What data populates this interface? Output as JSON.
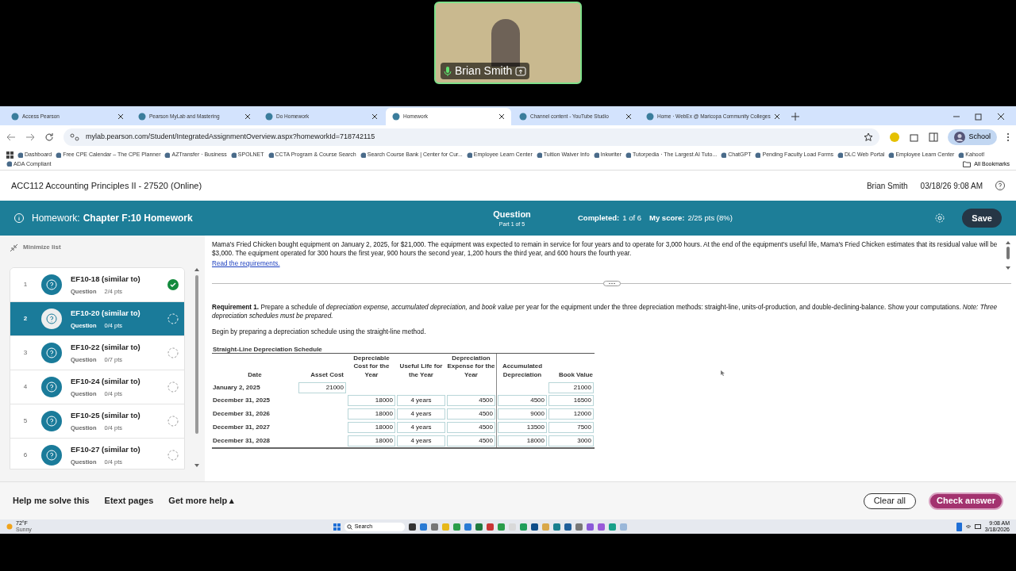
{
  "video_call": {
    "participant": "Brian Smith"
  },
  "browser": {
    "tabs": [
      {
        "title": "Access Pearson",
        "selected": false
      },
      {
        "title": "Pearson MyLab and Mastering",
        "selected": false
      },
      {
        "title": "Do Homework",
        "selected": false
      },
      {
        "title": "Homework",
        "selected": true
      },
      {
        "title": "Channel content - YouTube Studio",
        "selected": false
      },
      {
        "title": "Home · WebEx @ Maricopa Community Colleges",
        "selected": false
      }
    ],
    "url": "mylab.pearson.com/Student/IntegratedAssignmentOverview.aspx?homeworkId=718742115",
    "profile": "School",
    "bookmarks": [
      "Dashboard",
      "Free CPE Calendar – The CPE Planner",
      "AZTransfer · Business",
      "SPOLNET",
      "CCTA Program & Course Search",
      "Search Course Bank | Center for Cur...",
      "Employee Learn Center",
      "Tuition Waiver Info",
      "Inkwriter",
      "Tutorpedia · The Largest AI Tuto...",
      "ChatGPT",
      "Pending Faculty Load Forms",
      "DLC Web Portal",
      "Employee Learn Center",
      "Kahoot!",
      "ADA Compliant"
    ],
    "all_bookmarks": "All Bookmarks"
  },
  "course": {
    "title": "ACC112 Accounting Principles II - 27520 (Online)",
    "user": "Brian Smith",
    "datetime": "03/18/26 9:08 AM"
  },
  "homework_bar": {
    "label": "Homework:",
    "title": "Chapter F:10 Homework",
    "center_title": "Question",
    "part": "Part 1 of 5",
    "completed_label": "Completed:",
    "completed": "1 of 6",
    "score_label": "My score:",
    "score": "2/25 pts (8%)",
    "save": "Save"
  },
  "sidebar": {
    "minimize": "Minimize list",
    "items": [
      {
        "number": "1",
        "title": "EF10-18 (similar to)",
        "type": "Question",
        "points": "2/4 pts",
        "completed": true,
        "selected": false
      },
      {
        "number": "2",
        "title": "EF10-20 (similar to)",
        "type": "Question",
        "points": "0/4 pts",
        "completed": false,
        "selected": true
      },
      {
        "number": "3",
        "title": "EF10-22 (similar to)",
        "type": "Question",
        "points": "0/7 pts",
        "completed": false,
        "selected": false
      },
      {
        "number": "4",
        "title": "EF10-24 (similar to)",
        "type": "Question",
        "points": "0/4 pts",
        "completed": false,
        "selected": false
      },
      {
        "number": "5",
        "title": "EF10-25 (similar to)",
        "type": "Question",
        "points": "0/4 pts",
        "completed": false,
        "selected": false
      },
      {
        "number": "6",
        "title": "EF10-27 (similar to)",
        "type": "Question",
        "points": "0/4 pts",
        "completed": false,
        "selected": false
      }
    ]
  },
  "question": {
    "problem": "Mama's Fried Chicken bought equipment on January 2, 2025, for $21,000. The equipment was expected to remain in service for four years and to operate for 3,000 hours. At the end of the equipment's useful life, Mama's Fried Chicken estimates that its residual value will be $3,000. The equipment operated for 300 hours the first year, 900 hours the second year, 1,200 hours the third year, and 600 hours the fourth year.",
    "link": "Read the requirements.",
    "requirement": "**Requirement 1.** Prepare a schedule of *depreciation expense, accumulated depreciation,* and *book value* per year for the equipment under the three depreciation methods: straight-line, units-of-production, and double-declining-balance. Show your computations. *Note: Three depreciation schedules must be prepared.*",
    "instruction": "Begin by preparing a depreciation schedule using the straight-line method.",
    "table": {
      "title": "Straight-Line Depreciation Schedule",
      "columns": [
        "Date",
        "Asset Cost",
        "Depreciable Cost for the Year",
        "Useful Life for the Year",
        "Depreciation Expense for the Year",
        "Accumulated Depreciation",
        "Book Value"
      ],
      "rows": [
        {
          "cells": [
            "January 2, 2025",
            "21000",
            "",
            "",
            "",
            "",
            "21000"
          ]
        },
        {
          "cells": [
            "December 31, 2025",
            "",
            "18000",
            "4 years",
            "4500",
            "4500",
            "16500"
          ]
        },
        {
          "cells": [
            "December 31, 2026",
            "",
            "18000",
            "4 years",
            "4500",
            "9000",
            "12000"
          ]
        },
        {
          "cells": [
            "December 31, 2027",
            "",
            "18000",
            "4 years",
            "4500",
            "13500",
            "7500"
          ]
        },
        {
          "cells": [
            "December 31, 2028",
            "",
            "18000",
            "4 years",
            "4500",
            "18000",
            "3000"
          ]
        }
      ]
    }
  },
  "footer": {
    "help": [
      "Help me solve this",
      "Etext pages",
      "Get more help ▴"
    ],
    "clear": "Clear all",
    "check": "Check answer"
  },
  "taskbar": {
    "weather": "72°F",
    "weather_note": "Sunny",
    "search": "Search",
    "time": "9:08 AM",
    "date": "3/18/2026"
  }
}
